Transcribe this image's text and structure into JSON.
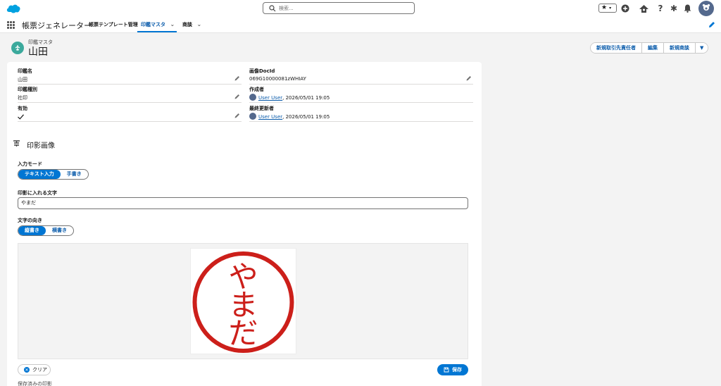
{
  "header": {
    "search_placeholder": "検索..."
  },
  "nav": {
    "app_name": "帳票ジェネレーター",
    "items": [
      {
        "label": "帳票テンプレート管理"
      },
      {
        "label": "印鑑マスタ"
      },
      {
        "label": "商談"
      }
    ]
  },
  "record": {
    "type_label": "印鑑マスタ",
    "title": "山田",
    "actions": [
      "新規取引先責任者",
      "編集",
      "新規商談"
    ]
  },
  "fields": {
    "seal_name_label": "印鑑名",
    "seal_name_value": "山田",
    "seal_type_label": "印鑑種別",
    "seal_type_value": "社印",
    "active_label": "有効",
    "image_docid_label": "画像DocId",
    "image_docid_value": "069G10000081zWHIAY",
    "created_by_label": "作成者",
    "created_by_user": "User User",
    "created_by_date": ", 2026/05/01 19:05",
    "modified_by_label": "最終更新者",
    "modified_by_user": "User User",
    "modified_by_date": ", 2026/05/01 19:05"
  },
  "seal_section": {
    "title": "印影画像",
    "input_mode_label": "入力モード",
    "input_mode_options": [
      "テキスト入力",
      "手書き"
    ],
    "text_label": "印影に入れる文字",
    "text_value": "やまだ",
    "direction_label": "文字の向き",
    "direction_options": [
      "縦書き",
      "横書き"
    ],
    "stamp_text": "やまだ",
    "stamp_color": "#cc1f1a",
    "clear_label": "クリア",
    "save_label": "保存",
    "saved_label": "保存済みの印影"
  },
  "colors": {
    "brand": "#0176d3",
    "record_icon": "#3ba99c"
  }
}
